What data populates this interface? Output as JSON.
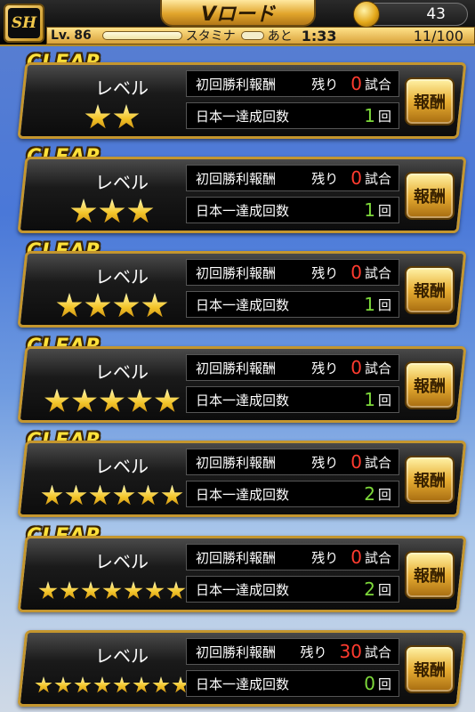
{
  "header": {
    "logo_text": "SH",
    "title": "Vロード",
    "coins": "43",
    "level_prefix": "Lv.",
    "level": "86",
    "stamina_label": "スタミナ",
    "ato_label": "あと",
    "time": "1:33",
    "stamina": "11/100"
  },
  "labels": {
    "clear": "CLEAR",
    "level": "レベル",
    "first_win": "初回勝利報酬",
    "remaining": "残り",
    "matches_unit": "試合",
    "japan_no1": "日本一達成回数",
    "times_unit": "回",
    "reward": "報酬"
  },
  "cards": [
    {
      "clear": true,
      "stars": 2,
      "remaining": "0",
      "achieved": "1"
    },
    {
      "clear": true,
      "stars": 3,
      "remaining": "0",
      "achieved": "1"
    },
    {
      "clear": true,
      "stars": 4,
      "remaining": "0",
      "achieved": "1"
    },
    {
      "clear": true,
      "stars": 5,
      "remaining": "0",
      "achieved": "1"
    },
    {
      "clear": true,
      "stars": 6,
      "remaining": "0",
      "achieved": "2"
    },
    {
      "clear": true,
      "stars": 7,
      "remaining": "0",
      "achieved": "2"
    },
    {
      "clear": false,
      "stars": 8,
      "remaining": "30",
      "achieved": "0"
    }
  ],
  "colors": {
    "accent_gold": "#e1a52c",
    "clear_yellow": "#ffe23b",
    "remaining_red": "#ff3b2f",
    "achieved_green": "#7dd83a"
  }
}
